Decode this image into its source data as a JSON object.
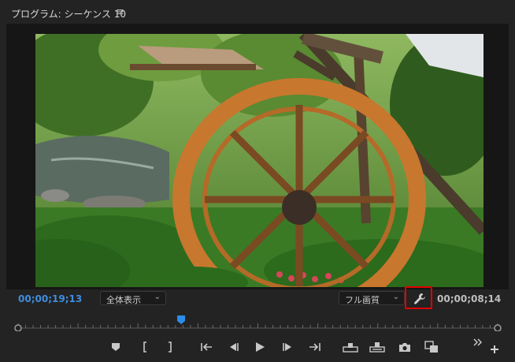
{
  "panel": {
    "title": "プログラム: シーケンス 10",
    "menu_glyph": "≡"
  },
  "monitor": {
    "current_timecode": "00;00;19;13",
    "duration_timecode": "00;00;08;14",
    "zoom_select": "全体表示",
    "quality_select": "フル画質",
    "playhead_position": 0.34
  },
  "colors": {
    "accent": "#3f8edf",
    "highlight": "#e00000"
  },
  "controls": [
    {
      "name": "add-marker-button",
      "icon": "marker-icon"
    },
    {
      "name": "mark-in-button",
      "icon": "mark-in-icon"
    },
    {
      "name": "mark-out-button",
      "icon": "mark-out-icon"
    },
    {
      "name": "go-to-in-button",
      "icon": "go-to-in-icon"
    },
    {
      "name": "step-back-button",
      "icon": "step-back-icon"
    },
    {
      "name": "play-button",
      "icon": "play-icon"
    },
    {
      "name": "step-forward-button",
      "icon": "step-forward-icon"
    },
    {
      "name": "go-to-out-button",
      "icon": "go-to-out-icon"
    },
    {
      "name": "lift-button",
      "icon": "lift-icon"
    },
    {
      "name": "extract-button",
      "icon": "extract-icon"
    },
    {
      "name": "export-frame-button",
      "icon": "camera-icon"
    },
    {
      "name": "compare-view-button",
      "icon": "compare-icon"
    },
    {
      "name": "more-controls-button",
      "icon": "chevron-double-right-icon"
    },
    {
      "name": "button-editor-button",
      "icon": "plus-icon"
    }
  ]
}
